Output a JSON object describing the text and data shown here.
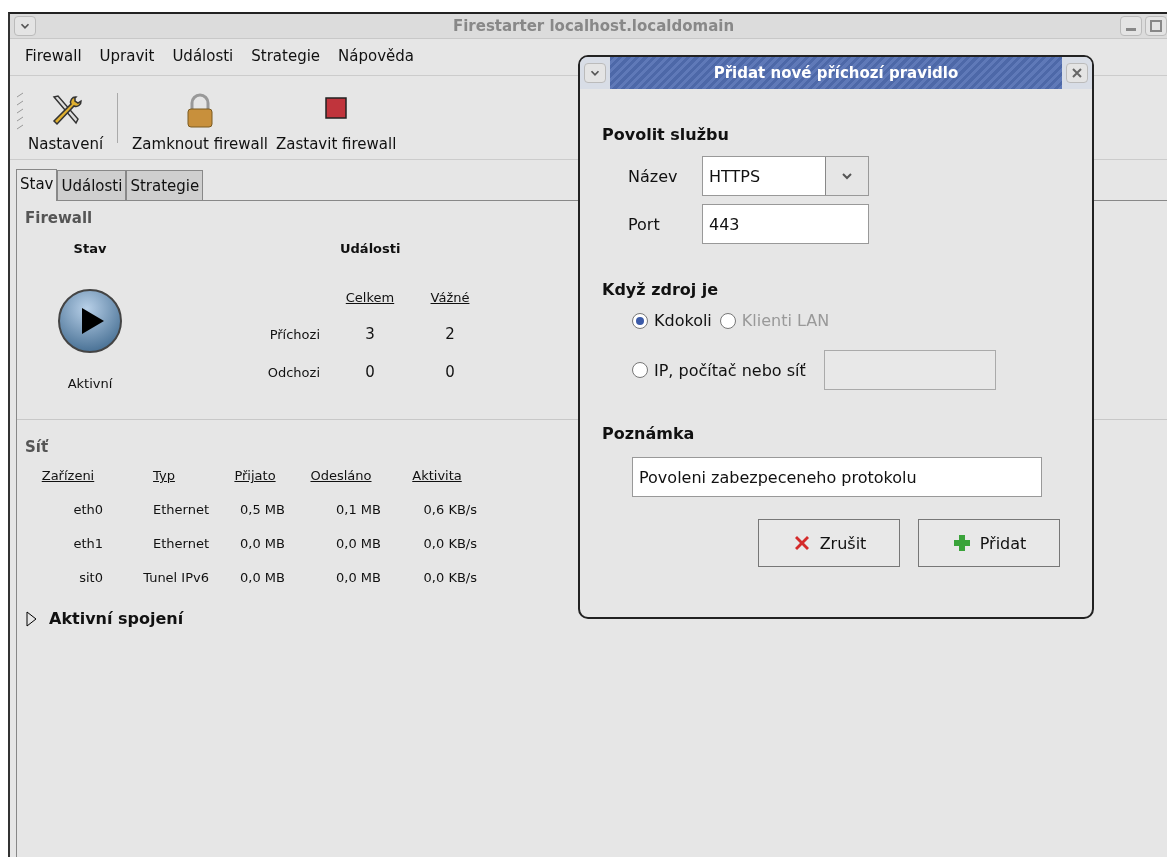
{
  "window": {
    "title": "Firestarter localhost.localdomain"
  },
  "menu": [
    {
      "label": "Firewall"
    },
    {
      "label": "Upravit"
    },
    {
      "label": "Události"
    },
    {
      "label": "Strategie"
    },
    {
      "label": "Nápověda"
    }
  ],
  "toolbar": [
    {
      "label": "Nastavení",
      "kind": "tools"
    },
    {
      "label": "Zamknout firewall",
      "kind": "lock"
    },
    {
      "label": "Zastavit firewall",
      "kind": "stop"
    }
  ],
  "tabs": [
    {
      "label": "Stav",
      "selected": true
    },
    {
      "label": "Události",
      "selected": false
    },
    {
      "label": "Strategie",
      "selected": false
    }
  ],
  "firewall": {
    "heading": "Firewall",
    "status_heading": "Stav",
    "status": "Aktivní",
    "events_heading": "Události",
    "events_columns": [
      "Celkem",
      "Vážné"
    ],
    "events_rows": [
      {
        "label": "Příchozi",
        "values": [
          "3",
          "2"
        ]
      },
      {
        "label": "Odchozi",
        "values": [
          "0",
          "0"
        ]
      }
    ]
  },
  "network": {
    "heading": "Síť",
    "columns": [
      "Zařízeni",
      "Typ",
      "Přijato",
      "Odesláno",
      "Aktivita"
    ],
    "rows": [
      [
        "eth0",
        "Ethernet",
        "0,5 MB",
        "0,1 MB",
        "0,6 KB/s"
      ],
      [
        "eth1",
        "Ethernet",
        "0,0 MB",
        "0,0 MB",
        "0,0 KB/s"
      ],
      [
        "sit0",
        "Tunel IPv6",
        "0,0 MB",
        "0,0 MB",
        "0,0 KB/s"
      ]
    ]
  },
  "connections": {
    "label": "Aktivní spojení",
    "expanded": false
  },
  "dialog": {
    "title": "Přidat nové příchozí pravidlo",
    "service_heading": "Povolit službu",
    "name_label": "Název",
    "name_value": "HTTPS",
    "port_label": "Port",
    "port_value": "443",
    "source_heading": "Když zdroj je",
    "sources": [
      {
        "label": "Kdokoli",
        "selected": true,
        "disabled": false
      },
      {
        "label": "Klienti LAN",
        "selected": false,
        "disabled": true
      },
      {
        "label": "IP, počítač nebo síť",
        "selected": false,
        "disabled": false
      }
    ],
    "ip_field": {
      "disabled": true
    },
    "note_heading": "Poznámka",
    "note_value": "Povoleni zabezpeceneho protokolu",
    "buttons": [
      {
        "label": "Zrušit",
        "kind": "cancel"
      },
      {
        "label": "Přidat",
        "kind": "add"
      }
    ]
  }
}
